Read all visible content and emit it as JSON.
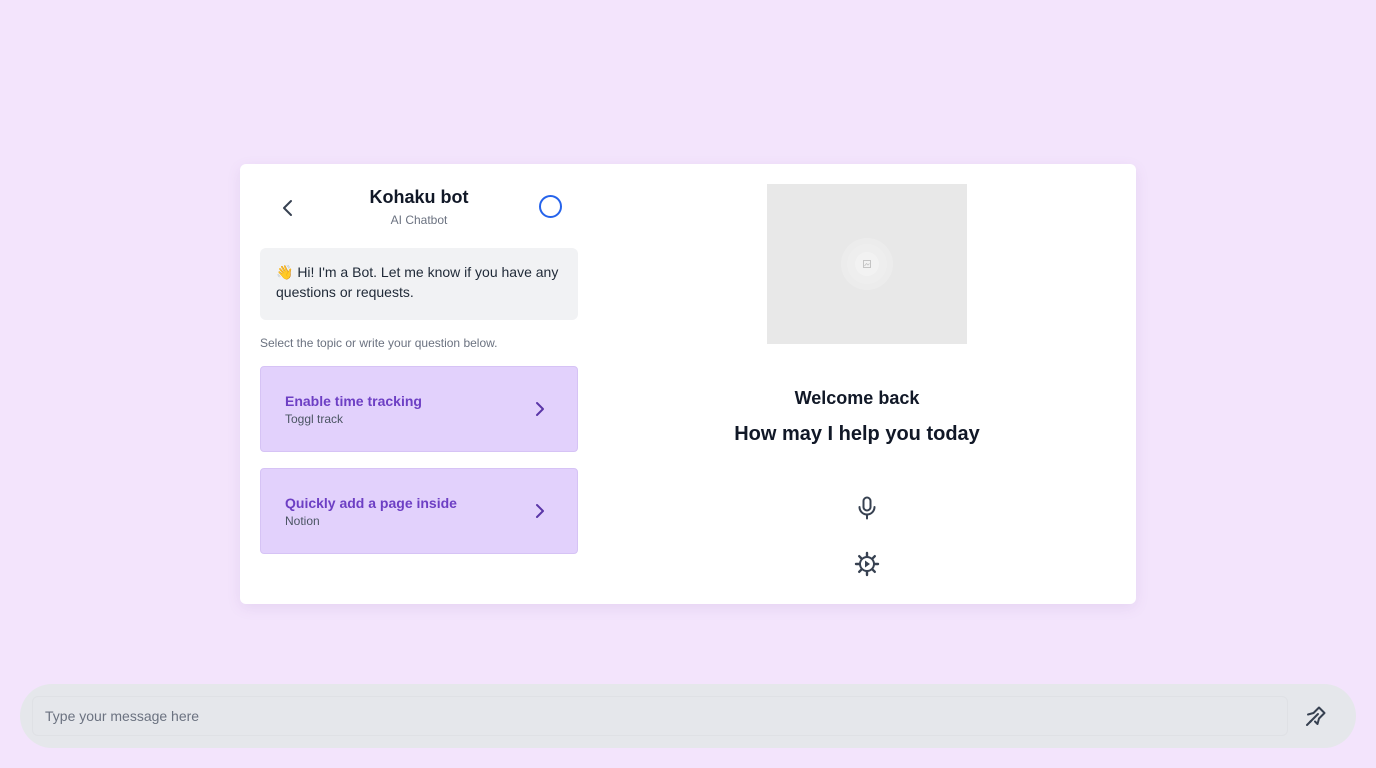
{
  "bot": {
    "name": "Kohaku bot",
    "subtitle": "AI Chatbot",
    "greeting": "👋 Hi! I'm a Bot. Let me know if you have any questions or requests.",
    "select_hint": "Select the topic or write your question below."
  },
  "topics": [
    {
      "title": "Enable time tracking",
      "subtitle": "Toggl track"
    },
    {
      "title": "Quickly add a page inside",
      "subtitle": "Notion"
    }
  ],
  "main": {
    "welcome": "Welcome back",
    "prompt": "How may I help you today"
  },
  "composer": {
    "placeholder": "Type your message here",
    "value": ""
  },
  "icons": {
    "back": "chevron-left-icon",
    "status": "circle-icon",
    "topic_arrow": "chevron-right-icon",
    "image": "image-placeholder-icon",
    "mic": "microphone-icon",
    "settings": "gear-icon",
    "send": "send-icon"
  },
  "colors": {
    "background": "#f3e4fc",
    "topic_bg": "#e2d1fc",
    "topic_title": "#6d3fc4",
    "status_ring": "#2563eb"
  }
}
